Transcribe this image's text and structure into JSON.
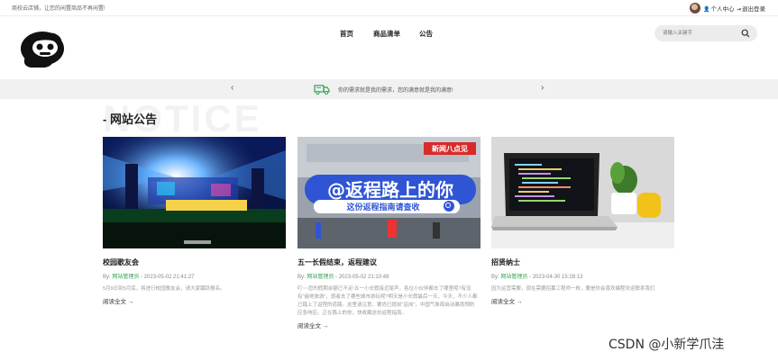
{
  "topbar": {
    "welcome": "商校云店铺，让您的闲置商品不再闲置!",
    "user_center": "个人中心",
    "logout": "退出登录",
    "icons": [
      "avatar",
      "user-icon",
      "logout-icon"
    ]
  },
  "nav": {
    "items": [
      {
        "label": "首页"
      },
      {
        "label": "商品清单"
      },
      {
        "label": "公告"
      }
    ]
  },
  "search": {
    "placeholder": "请输入关键字",
    "icon": "search-icon"
  },
  "banner": {
    "message": "你的需求就是我的需求，您的满意就是我的满意!",
    "prev": "‹",
    "next": "›",
    "icon": "truck-icon"
  },
  "section": {
    "title": "- 网站公告",
    "watermark": "NOTICE"
  },
  "notices": [
    {
      "title": "校园歌友会",
      "by": "By:",
      "author": "网站管理员",
      "date": "- 2023-05-02 21:41:27",
      "excerpt": "5月9日到5月底，将进行校园歌友会，请大家踊跃报名。",
      "more": "阅读全文 →",
      "image_text": ""
    },
    {
      "title": "五一长假结束，返程建议",
      "by": "By:",
      "author": "网站管理员",
      "date": "- 2023-05-02 21:10:48",
      "excerpt": "叮~~您的假期余额已不足!五一小长假接近尾声，各位小伙伴都去了哪里呢?有没有\"遍地旅游\"，感者去了哪些城市游玩呢?明天是小长假最后一天，今天，不少人都已踏上了返程的道路。这里请注意，要尚已提前\"返岗\"，中国气象局启动暴雨预防应急响应。正在路上的你，快收藏这份返程指南。",
      "more": "阅读全文 →",
      "image_text": {
        "brand": "新闻八点见",
        "headline": "@返程路上的你",
        "sub": "这份返程指南请查收"
      }
    },
    {
      "title": "招贤纳士",
      "by": "By:",
      "author": "网站管理员",
      "date": "- 2023-04-30 15:28:13",
      "excerpt": "因为运营需要，现在需要招募工程师一枚，要是你会喜欢编程欢迎联系我们",
      "more": "阅读全文 →",
      "image_text": ""
    }
  ],
  "footer_watermark": "CSDN @小新学爪洼",
  "colors": {
    "accent_green": "#2ea44f",
    "banner_bg": "#f1f1f1",
    "search_bg": "#ececec"
  }
}
